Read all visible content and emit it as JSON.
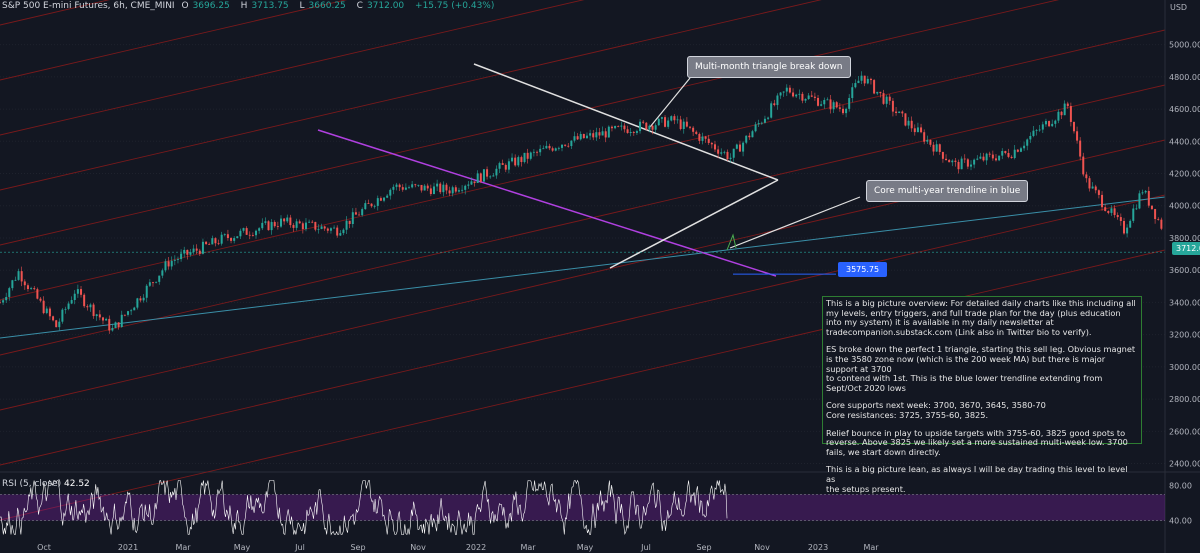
{
  "header": {
    "symbol": "S&P 500 E-mini Futures, 6h, CME_MINI",
    "open_label": "O",
    "open": "3696.25",
    "high_label": "H",
    "high": "3713.75",
    "low_label": "L",
    "low": "3660.25",
    "close_label": "C",
    "close": "3712.00",
    "change": "+15.75 (+0.43%)"
  },
  "rsi_header": {
    "label": "RSI (5, close)",
    "value": "42.52"
  },
  "currency": "USD",
  "callouts": {
    "triangle": "Multi-month triangle break down",
    "trendline": "Core multi-year trendline in blue"
  },
  "price_tag": "3712.00",
  "target_tag": "3575.75",
  "note": {
    "p1": "This is a big picture overview: For detailed daily charts like this including all my levels, entry triggers, and full trade plan for the day (plus education into my system) it is available in my daily newsletter at tradecompanion.substack.com (Link also in Twitter bio to verify).",
    "p2": "ES broke down the perfect 1 triangle, starting this sell leg. Obvious magnet is the 3580 zone now (which is the 200 week MA) but there is major support at 3700\nto contend with 1st. This is the blue lower trendline extending from Sept/Oct 2020 lows",
    "p3": "Core supports next week: 3700, 3670, 3645, 3580-70\nCore resistances: 3725, 3755-60, 3825.",
    "p4": "Relief bounce in play to upside targets with 3755-60, 3825 good spots to reverse. Above 3825 we likely set a more sustained multi-week low. 3700\nfails, we start down directly.",
    "p5": "This is a big picture lean, as always I will be day trading this level to level as\nthe setups present."
  },
  "colors": {
    "background": "#131722",
    "candle_up": "#26a69a",
    "candle_down": "#ef5350",
    "purple_trendline": "#b040e0",
    "blue_trendline": "#3a8fa8",
    "channel_lines": "#8b1a1a",
    "rsi_line": "#ffffff",
    "rsi_band": "#7b1fa2"
  },
  "chart_data": {
    "type": "candlestick",
    "price_axis": {
      "ticks": [
        2400,
        2600,
        2800,
        3000,
        3200,
        3400,
        3600,
        3800,
        4000,
        4200,
        4400,
        4600,
        4800,
        5000
      ],
      "ylim": [
        2360,
        5190
      ]
    },
    "time_axis": {
      "labels": [
        "Oct",
        "2021",
        "Mar",
        "May",
        "Jul",
        "Sep",
        "Nov",
        "2022",
        "Mar",
        "May",
        "Jul",
        "Sep",
        "Nov",
        "2023",
        "Mar"
      ]
    },
    "price_path": [
      [
        "2020-09",
        3400
      ],
      [
        "2020-09",
        3590
      ],
      [
        "2020-10",
        3250
      ],
      [
        "2020-10",
        3470
      ],
      [
        "2020-11",
        3230
      ],
      [
        "2020-12",
        3650
      ],
      [
        "2021-01",
        3800
      ],
      [
        "2021-02",
        3900
      ],
      [
        "2021-03",
        3850
      ],
      [
        "2021-04",
        4120
      ],
      [
        "2021-05",
        4100
      ],
      [
        "2021-06",
        4250
      ],
      [
        "2021-07",
        4390
      ],
      [
        "2021-08",
        4470
      ],
      [
        "2021-09",
        4530
      ],
      [
        "2021-10",
        4300
      ],
      [
        "2021-11",
        4720
      ],
      [
        "2021-12",
        4600
      ],
      [
        "2021-12",
        4810
      ],
      [
        "2022-01",
        4560
      ],
      [
        "2022-02",
        4250
      ],
      [
        "2022-03",
        4330
      ],
      [
        "2022-04",
        4620
      ],
      [
        "2022-04",
        4150
      ],
      [
        "2022-05",
        3850
      ],
      [
        "2022-05",
        4100
      ],
      [
        "2022-06",
        3650
      ],
      [
        "2022-07",
        3940
      ],
      [
        "2022-08",
        4320
      ],
      [
        "2022-09",
        3880
      ],
      [
        "2022-09",
        4120
      ],
      [
        "2022-09",
        3900
      ],
      [
        "2022-09",
        3660
      ],
      [
        "2022-09",
        3712
      ]
    ],
    "annotations": [
      "Multi-month triangle break down",
      "Core multi-year trendline in blue"
    ],
    "rsi": {
      "period": 5,
      "last": 42.52,
      "ticks": [
        40,
        80
      ],
      "band": [
        40,
        70
      ]
    },
    "levels": {
      "last_price": 3712.0,
      "target": 3575.75
    }
  }
}
